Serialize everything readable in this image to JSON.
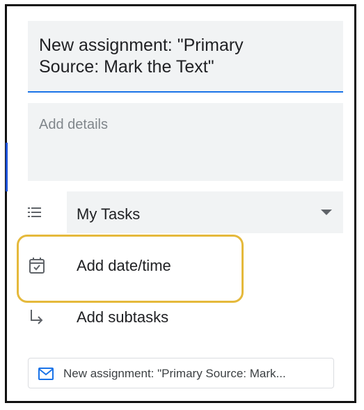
{
  "task": {
    "title": "New assignment: \"Primary\nSource: Mark the Text\"",
    "details_placeholder": "Add details",
    "list": {
      "selected": "My Tasks"
    },
    "date_action_label": "Add date/time",
    "subtasks_action_label": "Add subtasks",
    "source_chip_label": "New assignment: \"Primary Source: Mark..."
  },
  "colors": {
    "accent_blue": "#1a73e8",
    "highlight_gold": "#e5b93b",
    "field_bg": "#f1f3f4"
  },
  "icons": {
    "list": "list-icon",
    "calendar": "calendar-check-icon",
    "subtask": "subdirectory-arrow-icon",
    "email": "email-icon",
    "dropdown": "dropdown-caret-icon"
  }
}
